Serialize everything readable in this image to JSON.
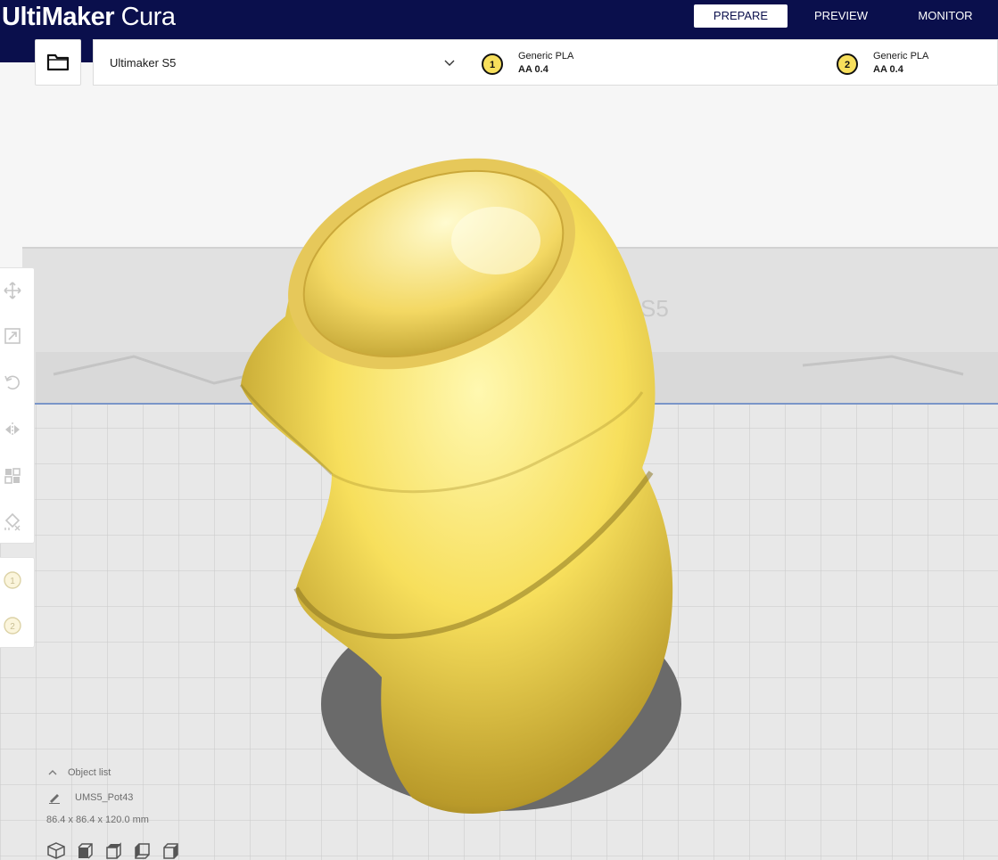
{
  "app": {
    "brand": "UltiMaker",
    "product": "Cura"
  },
  "tabs": [
    {
      "label": "PREPARE",
      "active": true
    },
    {
      "label": "PREVIEW",
      "active": false
    },
    {
      "label": "MONITOR",
      "active": false
    }
  ],
  "toolbar": {
    "open_icon": "folder-icon",
    "printer": "Ultimaker S5",
    "extruders": [
      {
        "number": "1",
        "material": "Generic PLA",
        "core": "AA 0.4"
      },
      {
        "number": "2",
        "material": "Generic PLA",
        "core": "AA 0.4"
      }
    ]
  },
  "viewport": {
    "buildplate_label": "S5",
    "model_color": "#f7df5c"
  },
  "tools": [
    "move-icon",
    "scale-icon",
    "rotate-icon",
    "mirror-icon",
    "per-model-settings-icon",
    "support-blocker-icon"
  ],
  "extruder_tools": [
    "1",
    "2"
  ],
  "object_list": {
    "title": "Object list",
    "object_name": "UMS5_Pot43",
    "dimensions": "86.4 x 86.4 x 120.0 mm"
  },
  "view_buttons": [
    "3d-view-icon",
    "front-view-icon",
    "top-view-icon",
    "left-view-icon",
    "right-view-icon"
  ],
  "colors": {
    "header_bg": "#0a0f4c",
    "accent": "#f7df5c"
  }
}
